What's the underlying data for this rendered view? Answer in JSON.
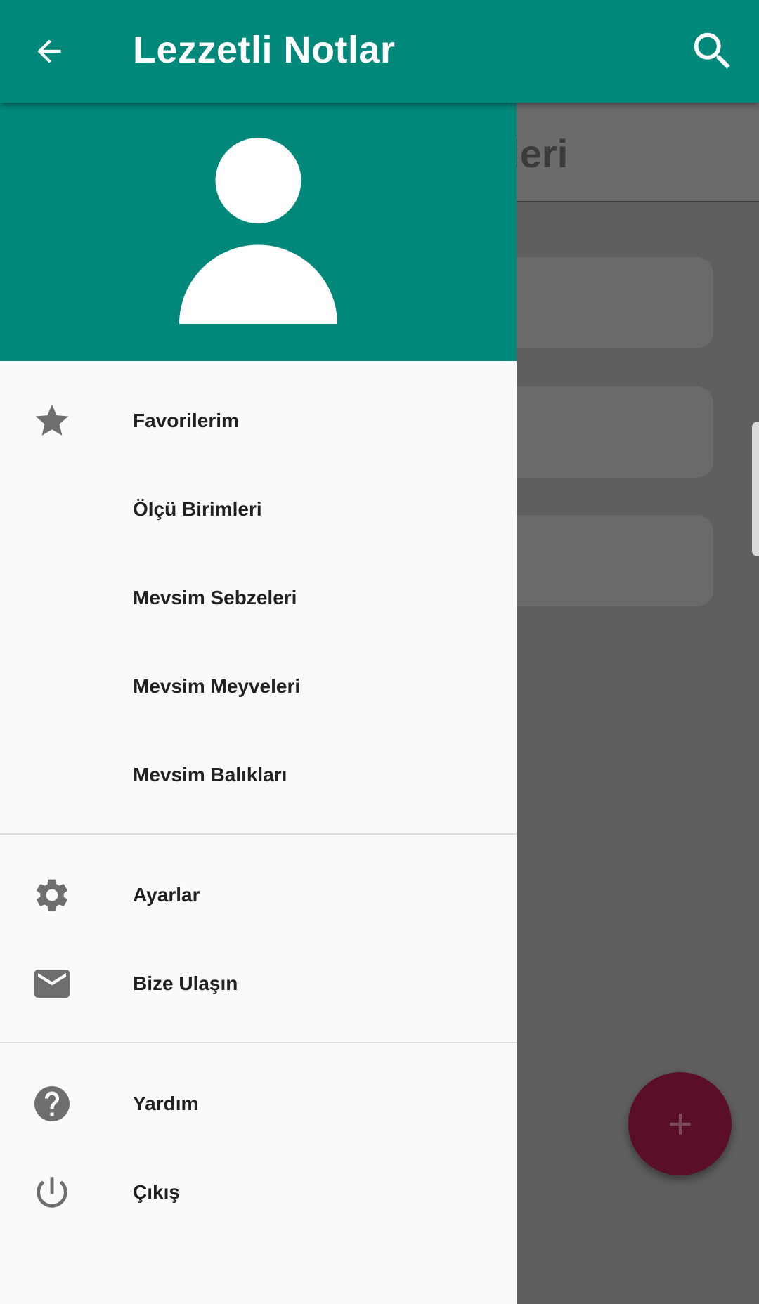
{
  "appbar": {
    "title": "Lezzetli Notlar",
    "back_icon": "arrow-back-icon",
    "search_icon": "search-icon",
    "color": "#00897b"
  },
  "background": {
    "title_fragment": "ifleri",
    "fab_icon": "plus-icon",
    "fab_color": "#5a0f27"
  },
  "drawer": {
    "avatar_icon": "person-avatar-icon",
    "groups": [
      [
        {
          "label": "Favorilerim",
          "icon": "star-icon"
        },
        {
          "label": "Ölçü Birimleri",
          "icon": ""
        },
        {
          "label": "Mevsim Sebzeleri",
          "icon": ""
        },
        {
          "label": "Mevsim Meyveleri",
          "icon": ""
        },
        {
          "label": "Mevsim Balıkları",
          "icon": ""
        }
      ],
      [
        {
          "label": "Ayarlar",
          "icon": "gear-icon"
        },
        {
          "label": "Bize Ulaşın",
          "icon": "mail-icon"
        }
      ],
      [
        {
          "label": "Yardım",
          "icon": "help-icon"
        },
        {
          "label": "Çıkış",
          "icon": "power-icon"
        }
      ]
    ]
  }
}
